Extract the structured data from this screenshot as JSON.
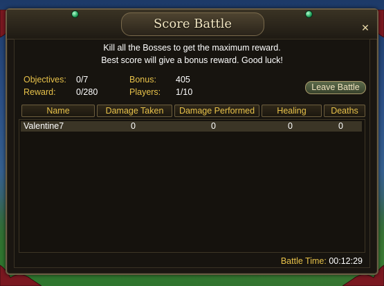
{
  "window": {
    "title": "Score Battle",
    "description_line1": "Kill all the Bosses to get the maximum reward.",
    "description_line2": "Best score will give a bonus reward. Good luck!"
  },
  "stats": {
    "objectives_label": "Objectives:",
    "objectives_value": "0/7",
    "reward_label": "Reward:",
    "reward_value": "0/280",
    "bonus_label": "Bonus:",
    "bonus_value": "405",
    "players_label": "Players:",
    "players_value": "1/10"
  },
  "leave_button_label": "Leave Battle",
  "table": {
    "columns": [
      "Name",
      "Damage Taken",
      "Damage Performed",
      "Healing",
      "Deaths"
    ],
    "rows": [
      {
        "name": "Valentine7",
        "damage_taken": "0",
        "damage_performed": "0",
        "healing": "0",
        "deaths": "0"
      }
    ]
  },
  "footer": {
    "battle_time_label": "Battle Time:",
    "battle_time_value": "00:12:29"
  },
  "colors": {
    "label_gold": "#e8c24a",
    "value_white": "#ffffff",
    "frame_border": "#6b5e45",
    "window_bg": "#1a1611"
  },
  "icons": [
    "close-icon",
    "gem-ornament-icon",
    "drape-ornament-icon"
  ]
}
